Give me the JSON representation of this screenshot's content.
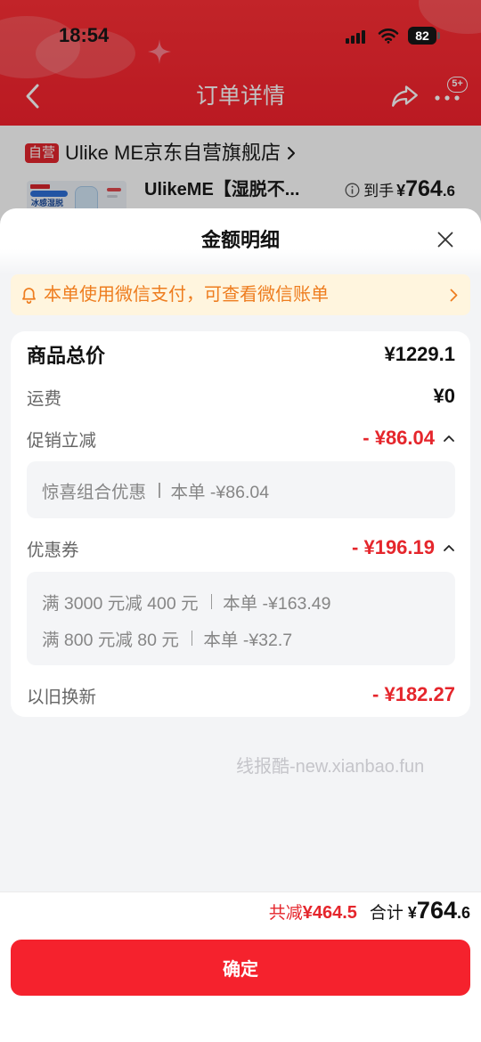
{
  "status_bar": {
    "time": "18:54",
    "battery": "82"
  },
  "nav": {
    "title": "订单详情",
    "more_badge": "5+"
  },
  "store": {
    "badge": "自营",
    "name": "Ulike ME京东自营旗舰店"
  },
  "product": {
    "title": "UlikeME【湿脱不...",
    "thumb_caption": "冰感湿脱",
    "price_label": "到手",
    "price_currency": "¥",
    "price_integer": "764",
    "price_decimal": ".6"
  },
  "sheet": {
    "title": "金额明细",
    "notice": "本单使用微信支付，可查看微信账单"
  },
  "breakdown": {
    "goods_total": {
      "label": "商品总价",
      "value": "¥1229.1"
    },
    "shipping": {
      "label": "运费",
      "value": "¥0"
    },
    "promotion": {
      "label": "促销立减",
      "value": "- ¥86.04",
      "expanded": true,
      "details": [
        {
          "name": "惊喜组合优惠",
          "amount": "本单 -¥86.04"
        }
      ]
    },
    "coupon": {
      "label": "优惠券",
      "value": "- ¥196.19",
      "expanded": true,
      "details": [
        {
          "name": "满 3000 元减 400 元",
          "amount": "本单 -¥163.49"
        },
        {
          "name": "满 800 元减 80 元",
          "amount": "本单 -¥32.7"
        }
      ]
    },
    "trade_in": {
      "label": "以旧换新",
      "value": "- ¥182.27"
    }
  },
  "watermark": "线报酷-new.xianbao.fun",
  "footer": {
    "saved_label": "共减",
    "saved_value": "¥464.5",
    "total_label": "合计",
    "total_currency": "¥",
    "total_integer": "764",
    "total_decimal": ".6",
    "confirm_label": "确定"
  },
  "colors": {
    "brand_red": "#f5222d",
    "price_red": "#e5262c",
    "notice_text": "#ee7d1f",
    "notice_background": "#fff5de",
    "sheet_background": "#f3f4f6"
  },
  "icons": [
    "back-icon",
    "share-icon",
    "more-icon",
    "bell-icon",
    "chevron-right-icon",
    "info-icon",
    "close-icon",
    "caret-up-icon",
    "signal-icon",
    "wifi-icon",
    "battery-icon"
  ]
}
